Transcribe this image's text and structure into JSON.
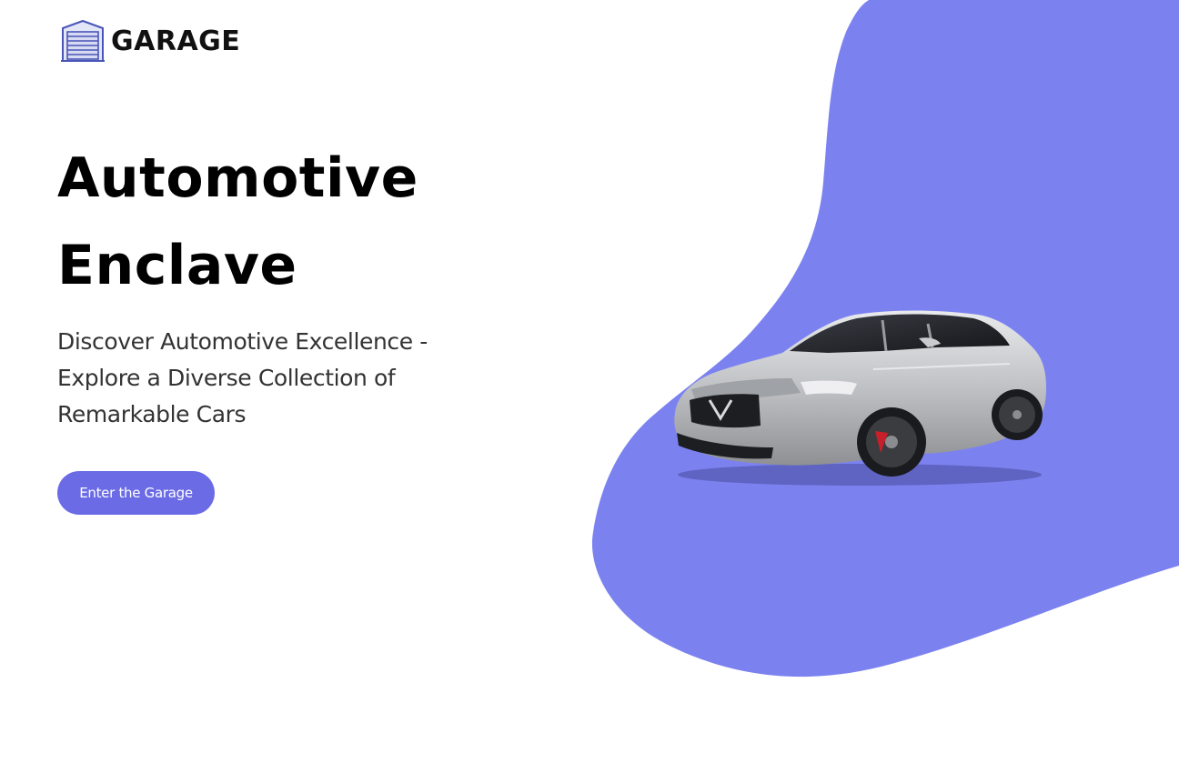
{
  "brand": {
    "logo_text": "GARAGE",
    "logo_icon": "garage-door-icon"
  },
  "hero": {
    "title_line1": "Automotive",
    "title_line2": "Enclave",
    "subtitle": "Discover Automotive Excellence - Explore a Diverse Collection of Remarkable Cars",
    "cta_label": "Enter the Garage"
  },
  "colors": {
    "accent": "#6b6be6",
    "blob": "#7b82f0",
    "title": "#000000",
    "subtitle": "#333333"
  },
  "images": {
    "hero_car": "silver-sedan-car-image"
  }
}
